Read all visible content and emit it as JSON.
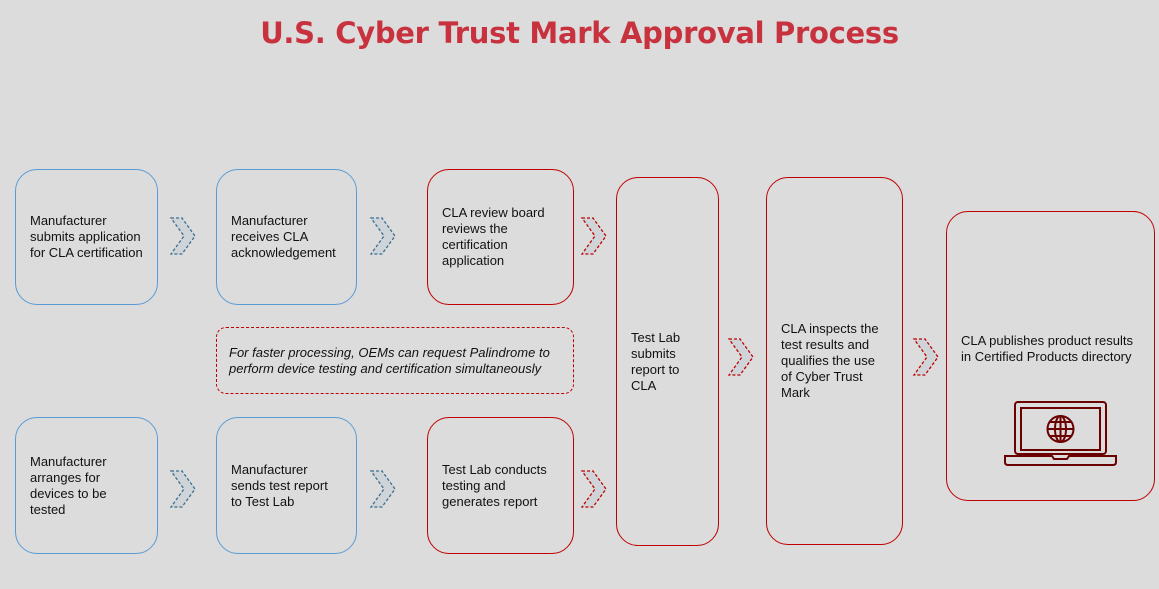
{
  "title": "U.S. Cyber Trust Mark Approval Process",
  "colors": {
    "title": "#c8323e",
    "manufacturer_border": "#5b9bd5",
    "cla_border": "#c00000",
    "chevron_fill": "#cfd4d8",
    "chevron_blue_stroke": "#3a6f8f",
    "chevron_red_stroke": "#c00000",
    "icon": "#6b0000",
    "background": "#dcdcdc"
  },
  "steps": {
    "top_row": [
      {
        "id": "submit-application",
        "text": "Manufacturer submits application for CLA certification",
        "actor": "manufacturer"
      },
      {
        "id": "receive-acknowledgement",
        "text": "Manufacturer receives CLA acknowledgement",
        "actor": "manufacturer"
      },
      {
        "id": "review-board",
        "text": "CLA review board reviews the certification application",
        "actor": "cla"
      }
    ],
    "bottom_row": [
      {
        "id": "arrange-devices",
        "text": "Manufacturer arranges for devices to be tested",
        "actor": "manufacturer"
      },
      {
        "id": "send-test-report",
        "text": "Manufacturer sends test report to Test Lab",
        "actor": "manufacturer"
      },
      {
        "id": "conduct-testing",
        "text": "Test Lab conducts testing and generates report",
        "actor": "cla"
      }
    ],
    "merged": [
      {
        "id": "submit-report",
        "text": "Test Lab submits report to CLA",
        "actor": "cla"
      },
      {
        "id": "inspect-results",
        "text": "CLA inspects the test results and qualifies the use of Cyber Trust Mark",
        "actor": "cla"
      },
      {
        "id": "publish-results",
        "text": "CLA publishes product results in Certified Products directory",
        "actor": "cla",
        "icon": "laptop-globe-icon"
      }
    ]
  },
  "note": "For faster processing, OEMs can request Palindrome to perform device testing and certification simultaneously"
}
